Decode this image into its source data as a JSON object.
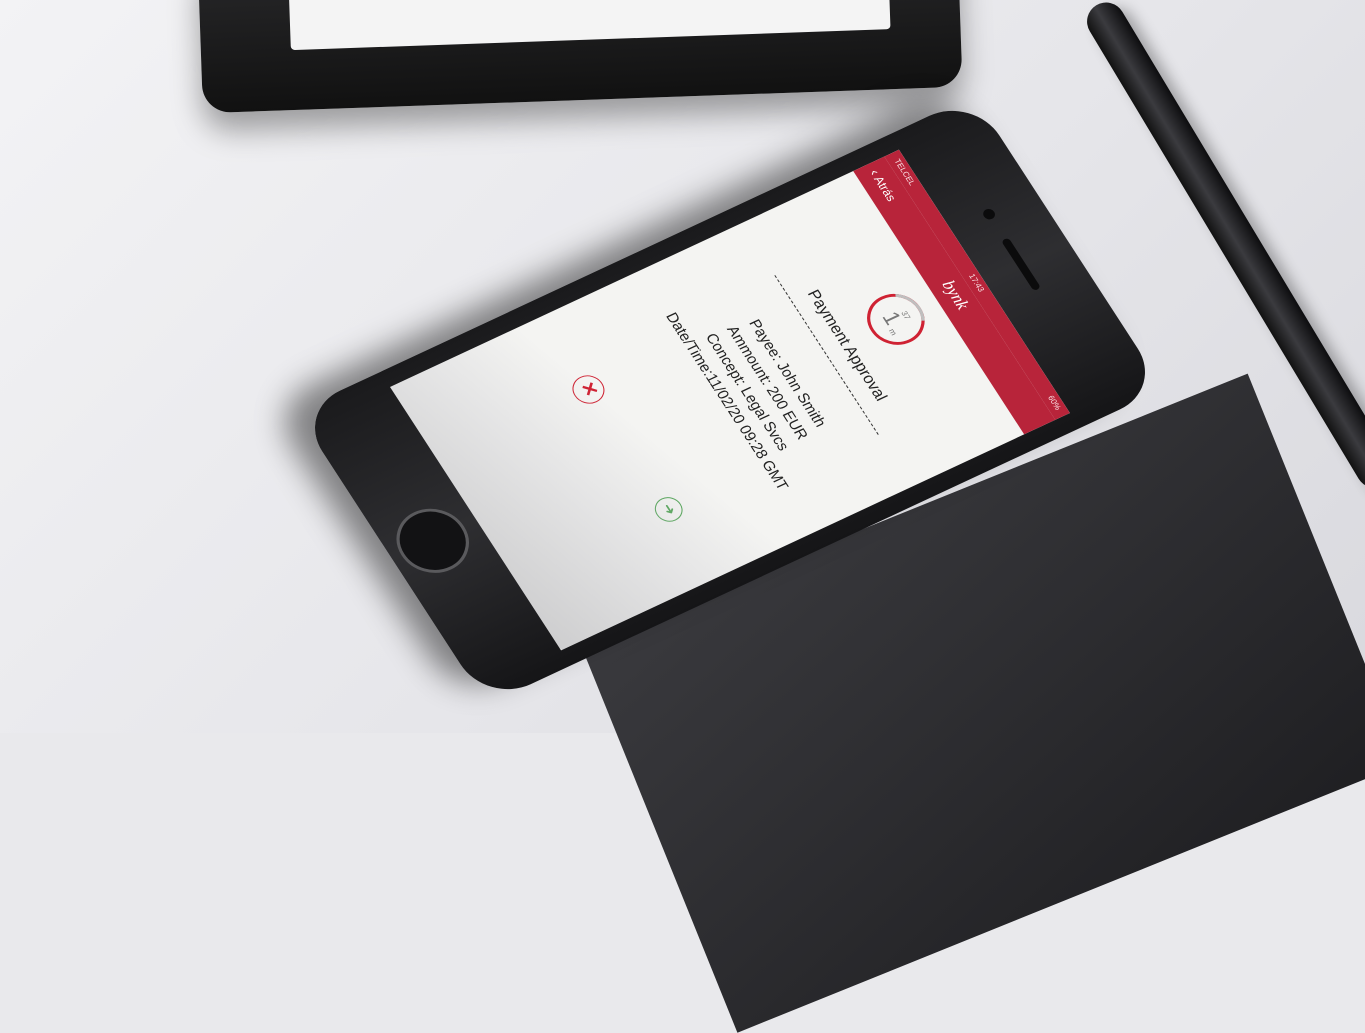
{
  "status_bar": {
    "carrier": "TELCEL",
    "time": "17:43",
    "battery": "60%"
  },
  "nav": {
    "back_label": "Atrás",
    "brand": "bynk"
  },
  "timer": {
    "seconds": "37",
    "minutes": "1",
    "unit": "m"
  },
  "approval": {
    "title": "Payment Approval",
    "payee": "Payee: John Smith",
    "amount": "Ammount: 200 EUR",
    "concept": "Concept: Legal Svcs",
    "datetime": "Date/Time:11/02/20 09:28 GMT"
  },
  "actions": {
    "approve_icon": "arrow-icon",
    "reject_icon": "close-icon"
  },
  "colors": {
    "brand_red": "#b8243a",
    "approve_green": "#4aa14e",
    "reject_red": "#cf2233"
  }
}
